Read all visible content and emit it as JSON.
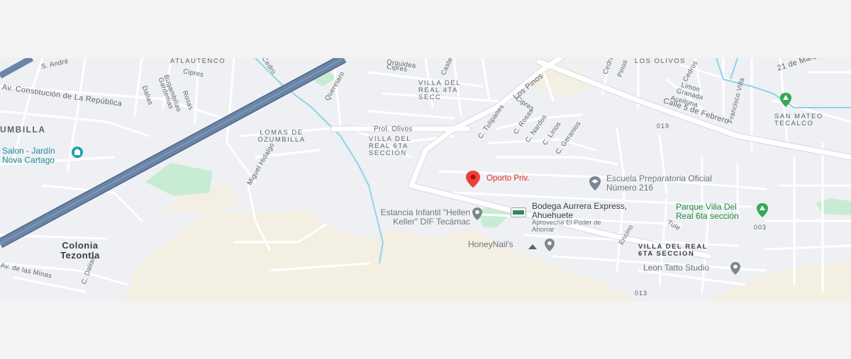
{
  "map": {
    "colors": {
      "background": "#eef0f3",
      "road": "#ffffff",
      "road_outline": "#d6d9de",
      "highway": "#6b85a8",
      "highway_edge": "#4f6685",
      "park": "#c8ecd3",
      "sand": "#f3efe2",
      "water": "#8fd2ec",
      "pin_red": "#ea4335",
      "pin_gray": "#7b8790",
      "pin_green": "#34a853",
      "pin_teal": "#1da1b1"
    },
    "marker": {
      "label": "Oporto Priv.",
      "icon": "red-location-pin-icon"
    },
    "street_labels": [
      "S. André",
      "ATLAUTENCO",
      "Cipres",
      "Av. Constitución de La República",
      "Dalias",
      "Gardenias",
      "Bugambilias",
      "Rosas",
      "Cedro",
      "Queretaro",
      "Orquidea",
      "Cipres",
      "Castel",
      "Los Pinos",
      "Cedro",
      "Pinos",
      "LOS OLIVOS",
      "21 de Marzo",
      "Cedros",
      "Limon",
      "Granada",
      "Aceituna",
      "Calle 5 de Febrero",
      "Francisco Villa",
      "Prol. Olivos",
      "Miguel Hidalgo",
      "C. Tulipanes",
      "C. Rosas",
      "C. Nardos",
      "Cipres",
      "C. Lirios",
      "C. Geranios",
      "Tule",
      "Encino",
      "Av. de las Minas",
      "C. Dalias"
    ],
    "area_labels": [
      "UMBILLA",
      "LOMAS DE OZUMBILLA",
      "VILLA DEL REAL 4TA SECC",
      "VILLA DEL REAL 6TA SECCIÓN",
      "VILLA DEL REAL 6TA SECCION",
      "SAN MATEO TECALCO"
    ],
    "place_labels": {
      "colonia": "Colonia Tezontla"
    },
    "road_codes": [
      "019",
      "003",
      "013"
    ],
    "pois": {
      "salon": {
        "name": "Salon - Jardín Nova Cartago",
        "icon": "event-venue-icon"
      },
      "escuela": {
        "name": "Escuela Preparatoria Oficial Número 216",
        "icon": "school-icon"
      },
      "parque": {
        "name": "Parque Villa Del Real 6ta sección",
        "icon": "park-tree-icon"
      },
      "estancia": {
        "name": "Estancia Infantil \"Hellen Keller\" DIF Tecámac",
        "icon": "place-pin-icon"
      },
      "bodega": {
        "name": "Bodega Aurrera Express, Ahuehuete",
        "tagline": "Aprovecha El Poder de Ahorrar",
        "icon": "store-icon"
      },
      "honeynails": {
        "name": "HoneyNail's",
        "icon": "place-pin-icon"
      },
      "leon": {
        "name": "Leon Tatto Studio",
        "icon": "place-pin-icon"
      },
      "san_mateo_park": {
        "icon": "park-tree-icon"
      }
    }
  }
}
